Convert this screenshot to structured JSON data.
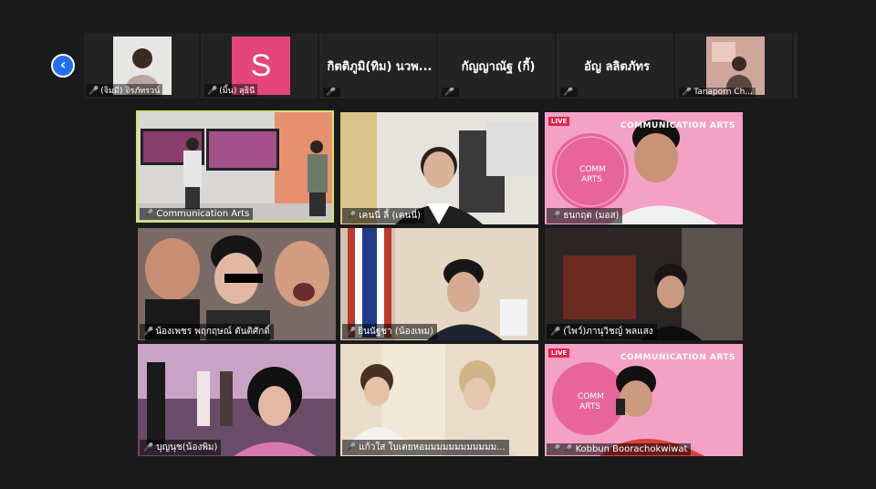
{
  "nav": {
    "back_icon": "chevron-left-icon",
    "back_glyph": "‹"
  },
  "strip": [
    {
      "label": "(จิมมี่) จิรภัทรวน์",
      "type": "photo",
      "muted": true
    },
    {
      "label": "(มิ้น) สุธินี",
      "type": "initial",
      "initial": "S",
      "muted": true
    },
    {
      "label": "",
      "type": "name",
      "big_name": "กิตติภูมิ(ทิม) นวพ...",
      "muted": true
    },
    {
      "label": "",
      "type": "name",
      "big_name": "กัญญาณัฐ (กี้)",
      "muted": true
    },
    {
      "label": "",
      "type": "name",
      "big_name": "อัญ ลลิตภัทร",
      "muted": true
    },
    {
      "label": "Tanaporn Ch...",
      "type": "photo",
      "muted": true
    }
  ],
  "tiles": [
    {
      "name": "Communication Arts",
      "active": true
    },
    {
      "name": "เคนนี่ ลี้ (เคนนี่)"
    },
    {
      "name": "ธนกฤต (มอส)",
      "live": true,
      "brand": "COMMUNICATION ARTS"
    },
    {
      "name": "น้องเพชร พฤกฤษณ์ ตันติศักดิ์",
      "muted": true
    },
    {
      "name": "ยินนัฐชา (น้องเพม)",
      "muted": true
    },
    {
      "name": "(ไพว์)ภานุวิชญ์ พลแสง"
    },
    {
      "name": "บุญนุช(น้องพิม)"
    },
    {
      "name": "แก้วใส ใบเตยหอมมมมมมมมมมมม..."
    },
    {
      "name": "Kobbun Boorachokwiwat",
      "muted": true,
      "live": true,
      "brand": "COMMUNICATION ARTS"
    }
  ],
  "live_label": "LIVE",
  "colors": {
    "background": "#1a1a1a",
    "active_border": "#d6e56a",
    "muted_mic": "#e0393e",
    "back_button": "#1f6ff2",
    "avatar_pink": "#e4457a"
  }
}
